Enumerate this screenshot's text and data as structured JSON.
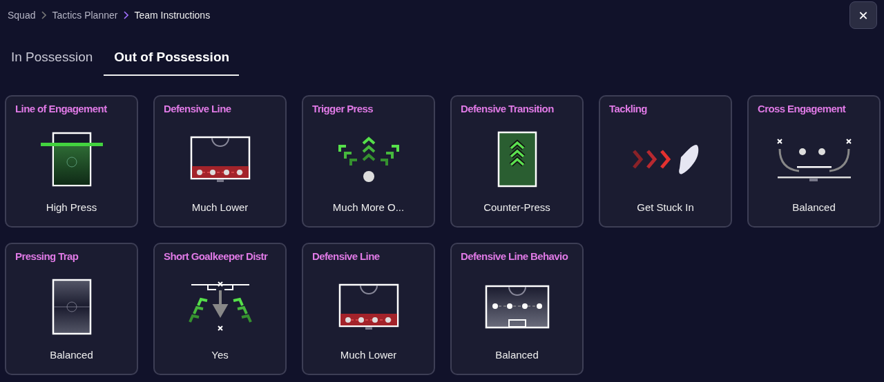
{
  "breadcrumb": [
    {
      "label": "Squad"
    },
    {
      "label": "Tactics Planner"
    },
    {
      "label": "Team Instructions"
    }
  ],
  "close_button": {
    "label": "✕"
  },
  "tabs": [
    {
      "label": "In Possession",
      "selected": false
    },
    {
      "label": "Out of Possession",
      "selected": true
    }
  ],
  "cards": [
    {
      "title": "Line of Engagement",
      "value": "High Press",
      "kind": "engagement"
    },
    {
      "title": "Defensive Line",
      "value": "Much Lower",
      "kind": "low-line"
    },
    {
      "title": "Trigger Press",
      "value": "Much More O...",
      "kind": "trigger"
    },
    {
      "title": "Defensive Transition",
      "value": "Counter-Press",
      "kind": "transition"
    },
    {
      "title": "Tackling",
      "value": "Get Stuck In",
      "kind": "tackling"
    },
    {
      "title": "Cross Engagement",
      "value": "Balanced",
      "kind": "cross"
    },
    {
      "title": "Pressing Trap",
      "value": "Balanced",
      "kind": "trap"
    },
    {
      "title": "Short Goalkeeper Distr",
      "value": "Yes",
      "kind": "goalkeeper"
    },
    {
      "title": "Defensive Line",
      "value": "Much Lower",
      "kind": "low-line"
    },
    {
      "title": "Defensive Line Behavio",
      "value": "Balanced",
      "kind": "behaviour"
    }
  ]
}
